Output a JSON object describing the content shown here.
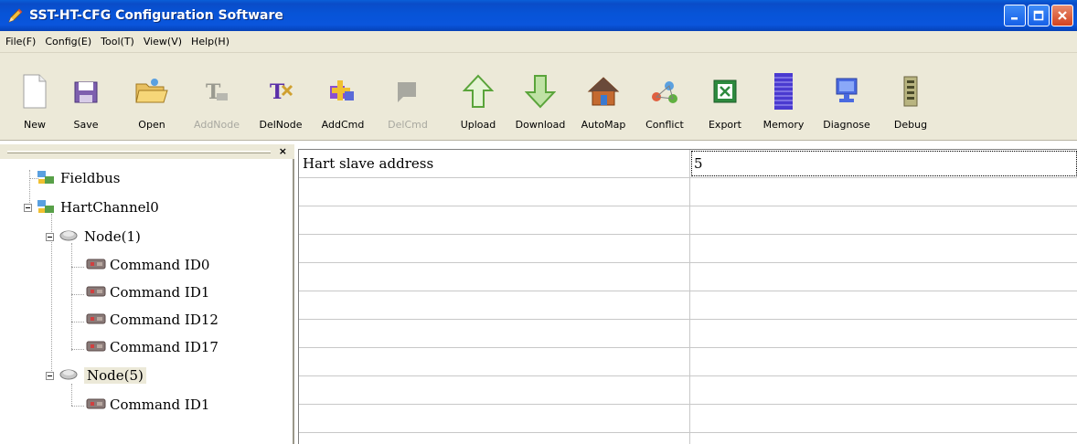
{
  "window": {
    "title": "SST-HT-CFG Configuration Software",
    "title_icon": "pencil-icon",
    "title_bar_color": "#0a55dc"
  },
  "menu": {
    "items": [
      "File(F)",
      "Config(E)",
      "Tool(T)",
      "View(V)",
      "Help(H)"
    ]
  },
  "toolbar": {
    "buttons": [
      {
        "label": "New",
        "icon": "new-file-icon",
        "enabled": true
      },
      {
        "label": "Save",
        "icon": "save-icon",
        "enabled": true
      },
      {
        "label": "Open",
        "icon": "open-folder-icon",
        "enabled": true
      },
      {
        "label": "AddNode",
        "icon": "add-node-icon",
        "enabled": false
      },
      {
        "label": "DelNode",
        "icon": "delete-node-icon",
        "enabled": true
      },
      {
        "label": "AddCmd",
        "icon": "add-command-icon",
        "enabled": true
      },
      {
        "label": "DelCmd",
        "icon": "delete-command-icon",
        "enabled": false
      },
      {
        "label": "Upload",
        "icon": "upload-arrow-icon",
        "enabled": true
      },
      {
        "label": "Download",
        "icon": "download-arrow-icon",
        "enabled": true
      },
      {
        "label": "AutoMap",
        "icon": "house-icon",
        "enabled": true
      },
      {
        "label": "Conflict",
        "icon": "conflict-icon",
        "enabled": true
      },
      {
        "label": "Export",
        "icon": "excel-icon",
        "enabled": true
      },
      {
        "label": "Memory",
        "icon": "memory-bars-icon",
        "enabled": true
      },
      {
        "label": "Diagnose",
        "icon": "monitor-icon",
        "enabled": true
      },
      {
        "label": "Debug",
        "icon": "debug-device-icon",
        "enabled": true
      }
    ]
  },
  "tree": {
    "close_label": "×",
    "nodes": [
      {
        "label": "Fieldbus",
        "icon": "network-icon",
        "level": 0
      },
      {
        "label": "HartChannel0",
        "icon": "network-icon",
        "level": 0,
        "expanded": true
      },
      {
        "label": "Node(1)",
        "icon": "node-icon",
        "level": 1,
        "expanded": true
      },
      {
        "label": "Command ID0",
        "icon": "command-icon",
        "level": 2
      },
      {
        "label": "Command ID1",
        "icon": "command-icon",
        "level": 2
      },
      {
        "label": "Command ID12",
        "icon": "command-icon",
        "level": 2
      },
      {
        "label": "Command ID17",
        "icon": "command-icon",
        "level": 2
      },
      {
        "label": "Node(5)",
        "icon": "node-icon",
        "level": 1,
        "expanded": true,
        "selected": true
      },
      {
        "label": "Command ID1",
        "icon": "command-icon",
        "level": 2
      }
    ]
  },
  "grid": {
    "rows": [
      {
        "name": "Hart slave address",
        "value": "5"
      },
      {
        "name": "",
        "value": ""
      },
      {
        "name": "",
        "value": ""
      },
      {
        "name": "",
        "value": ""
      },
      {
        "name": "",
        "value": ""
      },
      {
        "name": "",
        "value": ""
      },
      {
        "name": "",
        "value": ""
      },
      {
        "name": "",
        "value": ""
      },
      {
        "name": "",
        "value": ""
      },
      {
        "name": "",
        "value": ""
      }
    ]
  }
}
